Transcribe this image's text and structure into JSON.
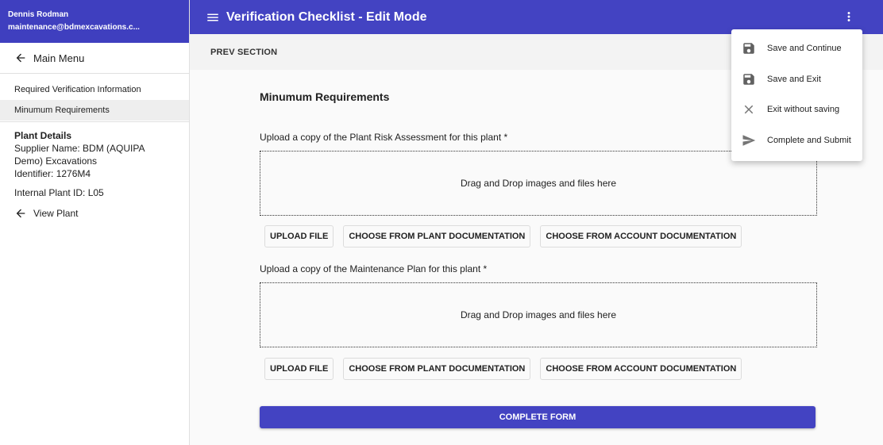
{
  "user": {
    "name": "Dennis Rodman",
    "email": "maintenance@bdmexcavations.c..."
  },
  "sidebar": {
    "main_menu": "Main Menu",
    "items": [
      {
        "label": "Required Verification Information",
        "active": false
      },
      {
        "label": "Minumum Requirements",
        "active": true
      }
    ],
    "plant_details": {
      "title": "Plant Details",
      "supplier": "Supplier Name: BDM (AQUIPA Demo) Excavations",
      "identifier": "Identifier: 1276M4",
      "internal_id": "Internal Plant ID: L05",
      "view_plant": "View Plant"
    }
  },
  "appbar": {
    "title": "Verification Checklist - Edit Mode",
    "icons": [
      "hamburger-menu-icon",
      "more-vert-icon"
    ]
  },
  "subbar": {
    "prev_section": "PREV SECTION"
  },
  "form": {
    "section_title": "Minumum Requirements",
    "uploads": [
      {
        "label": "Upload a copy of the Plant Risk Assessment for this plant *",
        "dropzone_text": "Drag and Drop images and files here",
        "buttons": [
          "UPLOAD FILE",
          "CHOOSE FROM PLANT DOCUMENTATION",
          "CHOOSE FROM ACCOUNT DOCUMENTATION"
        ]
      },
      {
        "label": "Upload a copy of the Maintenance Plan for this plant *",
        "dropzone_text": "Drag and Drop images and files here",
        "buttons": [
          "UPLOAD FILE",
          "CHOOSE FROM PLANT DOCUMENTATION",
          "CHOOSE FROM ACCOUNT DOCUMENTATION"
        ]
      }
    ],
    "complete_button": "COMPLETE FORM"
  },
  "menu": {
    "items": [
      {
        "label": "Save and Continue",
        "icon": "save-icon"
      },
      {
        "label": "Save and Exit",
        "icon": "save-icon"
      },
      {
        "label": "Exit without saving",
        "icon": "close-icon"
      },
      {
        "label": "Complete and Submit",
        "icon": "send-icon"
      }
    ]
  },
  "colors": {
    "primary": "#4343c2",
    "user_header": "#3f3fbf",
    "subbar": "#f3f3f3",
    "background": "#fafafa"
  }
}
